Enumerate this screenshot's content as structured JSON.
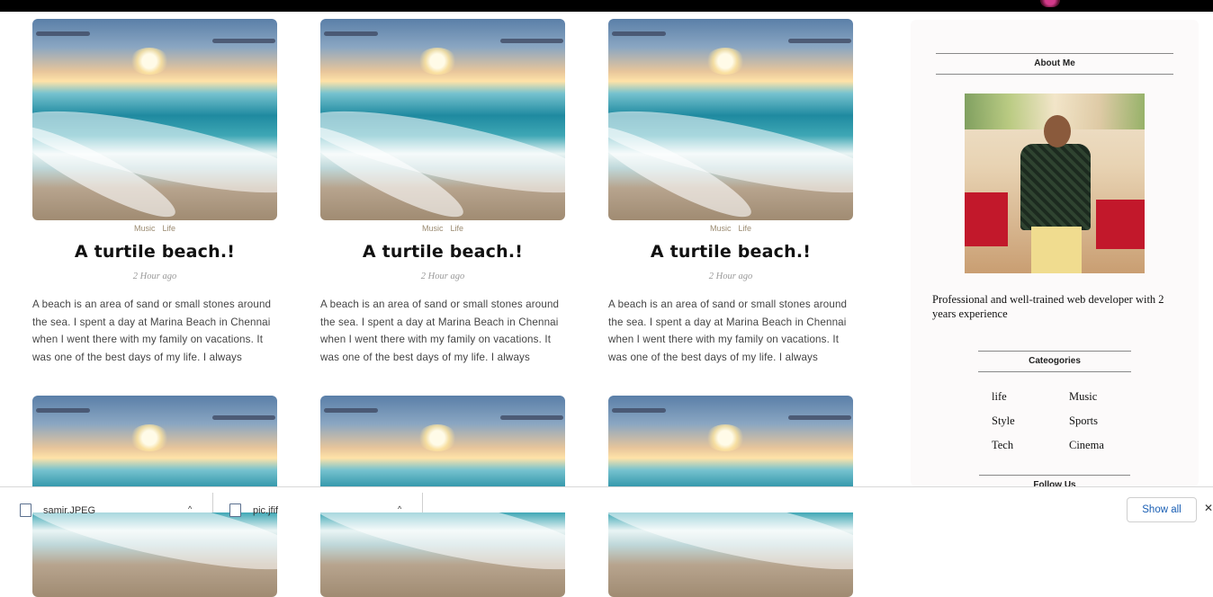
{
  "posts": [
    {
      "tags": [
        "Music",
        "Life"
      ],
      "title": "A turtile beach.!",
      "time": "2 Hour ago",
      "excerpt": "A beach is an area of sand or small stones around the sea. I spent a day at Marina Beach in Chennai when I went there with my family on vacations. It was one of the best days of my life. I always wante..."
    },
    {
      "tags": [
        "Music",
        "Life"
      ],
      "title": "A turtile beach.!",
      "time": "2 Hour ago",
      "excerpt": "A beach is an area of sand or small stones around the sea. I spent a day at Marina Beach in Chennai when I went there with my family on vacations. It was one of the best days of my life. I always wante..."
    },
    {
      "tags": [
        "Music",
        "Life"
      ],
      "title": "A turtile beach.!",
      "time": "2 Hour ago",
      "excerpt": "A beach is an area of sand or small stones around the sea. I spent a day at Marina Beach in Chennai when I went there with my family on vacations. It was one of the best days of my life. I always wante..."
    }
  ],
  "sidebar": {
    "about_heading": "About Me",
    "about_text": "Professional and well-trained web developer with 2 years experience",
    "categories_heading": "Cateogories",
    "categories": [
      "life",
      "Music",
      "Style",
      "Sports",
      "Tech",
      "Cinema"
    ],
    "follow_heading": "Follow Us"
  },
  "downloads": {
    "items": [
      {
        "name": "samir.JPEG",
        "icon": "file-icon"
      },
      {
        "name": "pic.jfif",
        "icon": "file-icon"
      }
    ],
    "show_all_label": "Show all",
    "caret": "^",
    "close": "✕"
  }
}
